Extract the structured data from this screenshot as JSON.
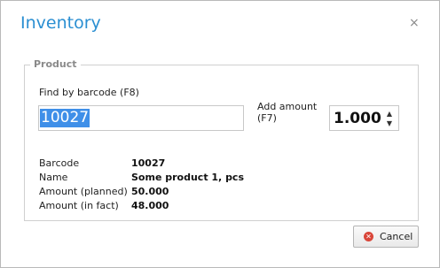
{
  "dialog": {
    "title": "Inventory",
    "close_glyph": "×"
  },
  "product": {
    "legend": "Product",
    "find_label": "Find by barcode (F8)",
    "barcode_value": "10027",
    "add_amount_label": "Add amount (F7)",
    "add_amount_value": "1.000",
    "details": [
      {
        "label": "Barcode",
        "value": "10027"
      },
      {
        "label": "Name",
        "value": "Some product 1, pcs"
      },
      {
        "label": "Amount (planned)",
        "value": "50.000"
      },
      {
        "label": "Amount (in fact)",
        "value": "48.000"
      }
    ]
  },
  "footer": {
    "cancel_label": "Cancel",
    "cancel_icon": "cancel-circle-icon"
  },
  "colors": {
    "title": "#2b8fd2",
    "selection": "#3f8fe8",
    "cancel_icon": "#d9463a"
  }
}
